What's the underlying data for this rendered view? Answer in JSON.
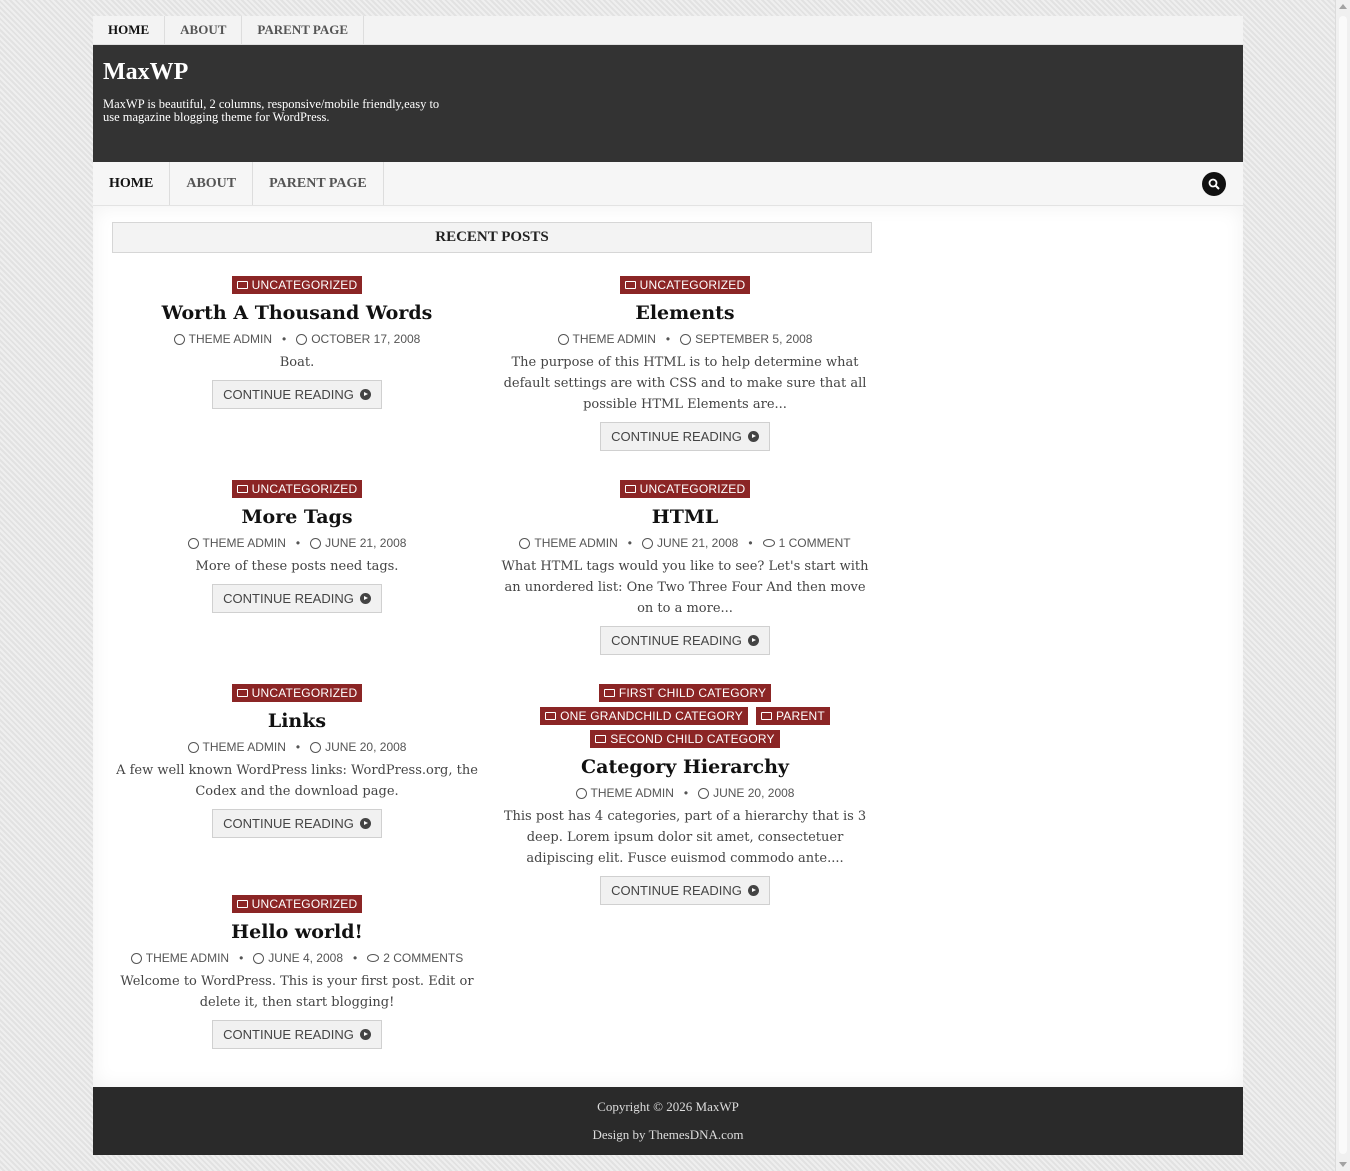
{
  "top_nav": [
    "HOME",
    "ABOUT",
    "PARENT PAGE"
  ],
  "site": {
    "title": "MaxWP",
    "description": "MaxWP is beautiful, 2 columns, responsive/mobile friendly,easy to use magazine blogging theme for WordPress."
  },
  "main_nav": [
    "HOME",
    "ABOUT",
    "PARENT PAGE"
  ],
  "recent_posts_label": "RECENT POSTS",
  "read_more_label": "CONTINUE READING",
  "posts": [
    {
      "categories": [
        "UNCATEGORIZED"
      ],
      "title": "Worth A Thousand Words",
      "author": "THEME ADMIN",
      "date": "OCTOBER 17, 2008",
      "comments": "",
      "excerpt": "Boat."
    },
    {
      "categories": [
        "UNCATEGORIZED"
      ],
      "title": "Elements",
      "author": "THEME ADMIN",
      "date": "SEPTEMBER 5, 2008",
      "comments": "",
      "excerpt": "The purpose of this HTML is to help determine what default settings are with CSS and to make sure that all possible HTML Elements are..."
    },
    {
      "categories": [
        "UNCATEGORIZED"
      ],
      "title": "More Tags",
      "author": "THEME ADMIN",
      "date": "JUNE 21, 2008",
      "comments": "",
      "excerpt": "More of these posts need tags."
    },
    {
      "categories": [
        "UNCATEGORIZED"
      ],
      "title": "HTML",
      "author": "THEME ADMIN",
      "date": "JUNE 21, 2008",
      "comments": "1 COMMENT",
      "excerpt": "What HTML tags would you like to see? Let's start with an unordered list: One Two Three Four And then move on to a more..."
    },
    {
      "categories": [
        "UNCATEGORIZED"
      ],
      "title": "Links",
      "author": "THEME ADMIN",
      "date": "JUNE 20, 2008",
      "comments": "",
      "excerpt": "A few well known WordPress links: WordPress.org, the Codex and the download page."
    },
    {
      "categories": [
        "FIRST CHILD CATEGORY",
        "ONE GRANDCHILD CATEGORY",
        "PARENT",
        "SECOND CHILD CATEGORY"
      ],
      "title": "Category Hierarchy",
      "author": "THEME ADMIN",
      "date": "JUNE 20, 2008",
      "comments": "",
      "excerpt": "This post has 4 categories, part of a hierarchy that is 3 deep. Lorem ipsum dolor sit amet, consectetuer adipiscing elit. Fusce euismod commodo ante...."
    },
    {
      "categories": [
        "UNCATEGORIZED"
      ],
      "title": "Hello world!",
      "author": "THEME ADMIN",
      "date": "JUNE 4, 2008",
      "comments": "2 COMMENTS",
      "excerpt": "Welcome to WordPress. This is your first post. Edit or delete it, then start blogging!"
    }
  ],
  "footer": {
    "copyright": "Copyright © 2026 MaxWP",
    "design": "Design by ThemesDNA.com"
  }
}
